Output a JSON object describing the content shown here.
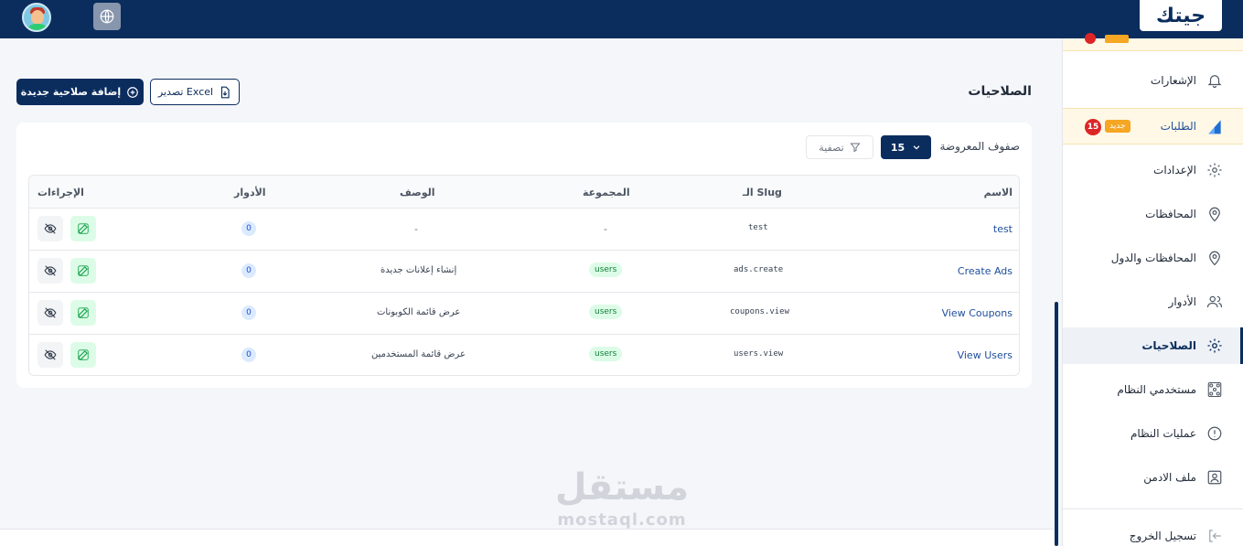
{
  "header": {
    "logo_text": "جيتك",
    "user": {
      "avatar_icon": "user-avatar"
    },
    "language_icon": "globe-icon"
  },
  "sidebar": {
    "items": [
      {
        "label": "الإشعارات",
        "icon": "bell-icon"
      },
      {
        "label": "الطلبات",
        "icon": "orders-icon",
        "badge_new": "جديد",
        "badge_count": "15"
      },
      {
        "label": "الإعدادات",
        "icon": "gear-icon"
      },
      {
        "label": "المحافظات",
        "icon": "location-icon"
      },
      {
        "label": "المحافظات والدول",
        "icon": "location-icon"
      },
      {
        "label": "الأدوار",
        "icon": "users-icon"
      },
      {
        "label": "الصلاحيات",
        "icon": "gear-icon",
        "active": true
      },
      {
        "label": "مستخدمي النظام",
        "icon": "team-icon"
      },
      {
        "label": "عمليات النظام",
        "icon": "alert-icon"
      },
      {
        "label": "ملف الادمن",
        "icon": "profile-icon"
      },
      {
        "label": "تسجيل الخروج",
        "icon": "logout-icon"
      }
    ]
  },
  "page": {
    "title": "الصلاحيات",
    "add_button": "إضافة صلاحية جديدة",
    "export_button": "تصدير Excel"
  },
  "toolbar": {
    "rows_label": "صفوف المعروضة",
    "rows_value": "15",
    "filter_label": "تصفية"
  },
  "table": {
    "headers": {
      "name": "الاسم",
      "slug": "الـ Slug",
      "group": "المجموعة",
      "description": "الوصف",
      "roles": "الأدوار",
      "actions": "الإجراءات"
    },
    "rows": [
      {
        "name": "test",
        "slug": "test",
        "group": "-",
        "description": "-",
        "roles": "0"
      },
      {
        "name": "Create Ads",
        "slug": "ads.create",
        "group": "users",
        "description": "إنشاء إعلانات جديدة",
        "roles": "0"
      },
      {
        "name": "View Coupons",
        "slug": "coupons.view",
        "group": "users",
        "description": "عرض قائمة الكوبونات",
        "roles": "0"
      },
      {
        "name": "View Users",
        "slug": "users.view",
        "group": "users",
        "description": "عرض قائمة المستخدمين",
        "roles": "0"
      }
    ]
  },
  "watermark": {
    "arabic": "مستقل",
    "latin": "mostaql.com"
  },
  "colors": {
    "primary": "#0b2d5e",
    "accent": "#f5a623",
    "success": "#16803c",
    "danger": "#dc2626"
  }
}
